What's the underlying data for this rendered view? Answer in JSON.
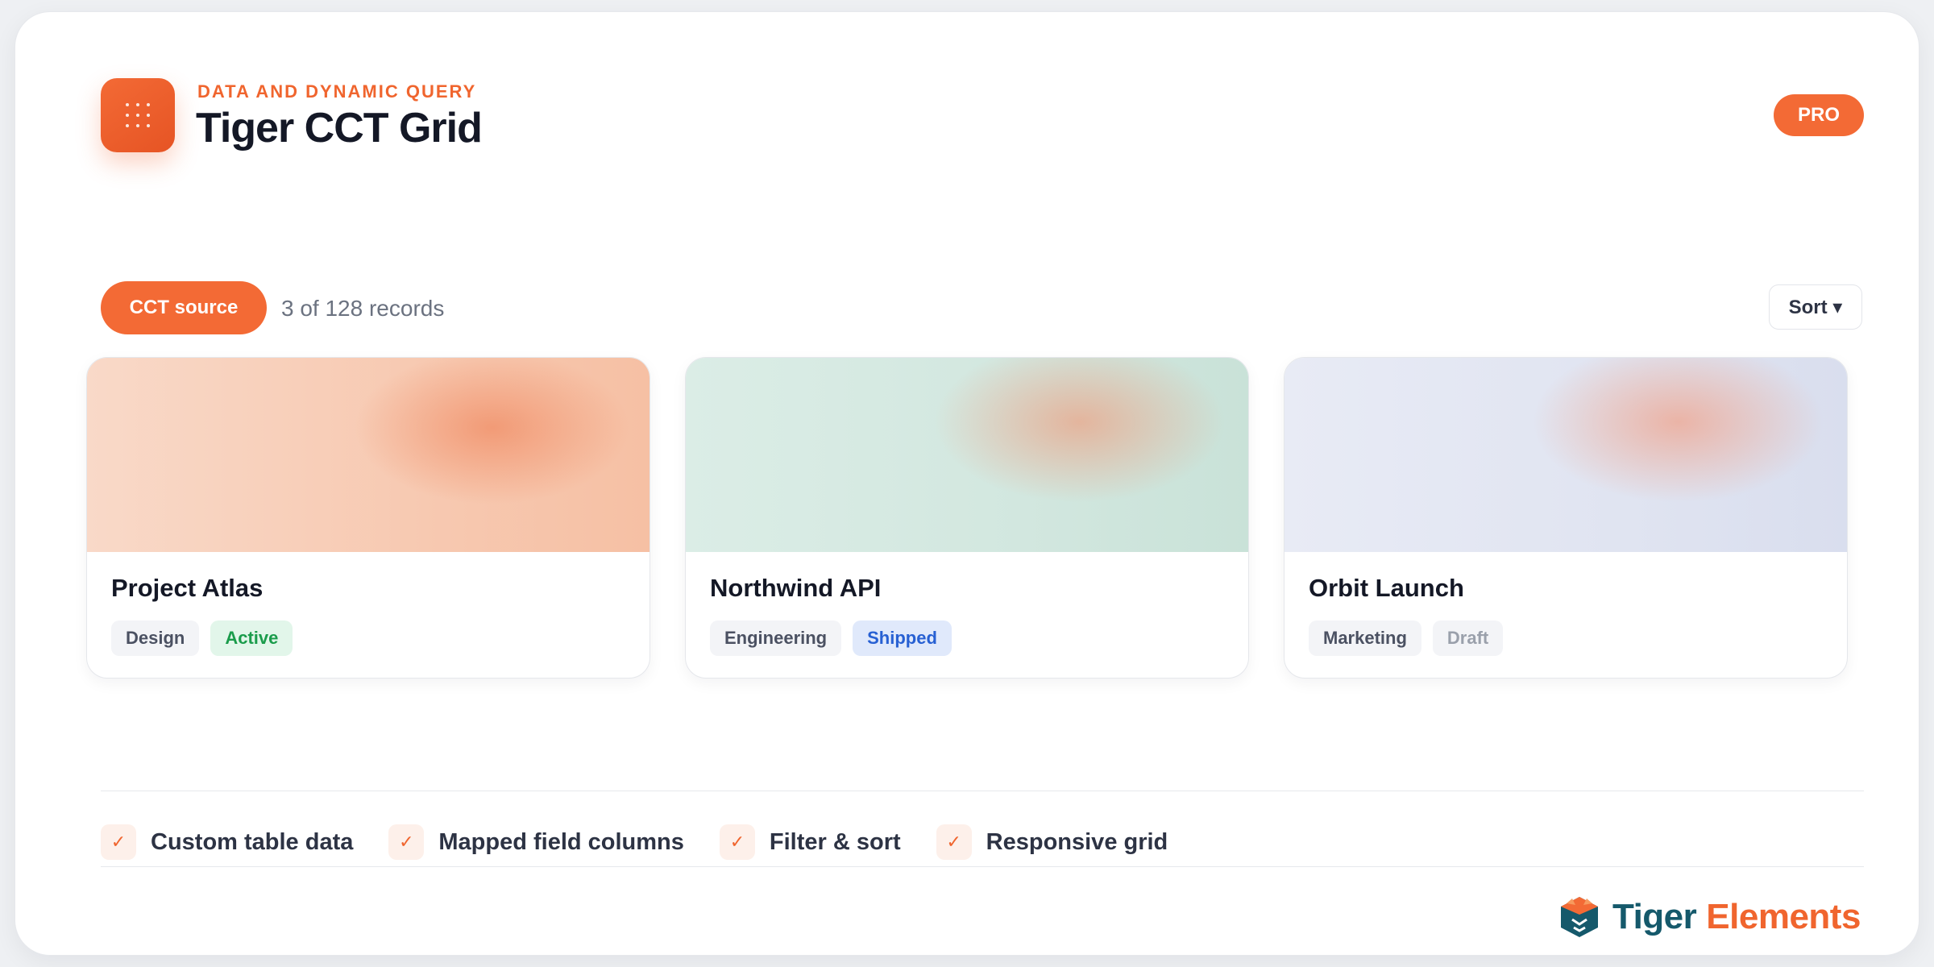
{
  "header": {
    "eyebrow": "DATA AND DYNAMIC QUERY",
    "title": "Tiger CCT Grid",
    "badge": "PRO",
    "icon": "grid-dots-icon"
  },
  "toolbar": {
    "source_label": "CCT source",
    "record_count": "3 of 128 records",
    "sort_label": "Sort ▾"
  },
  "cards": [
    {
      "title": "Project Atlas",
      "category": "Design",
      "status": "Active"
    },
    {
      "title": "Northwind API",
      "category": "Engineering",
      "status": "Shipped"
    },
    {
      "title": "Orbit Launch",
      "category": "Marketing",
      "status": "Draft"
    }
  ],
  "features": [
    {
      "icon": "check-icon",
      "label": "Custom table data"
    },
    {
      "icon": "check-icon",
      "label": "Mapped field columns"
    },
    {
      "icon": "check-icon",
      "label": "Filter & sort"
    },
    {
      "icon": "check-icon",
      "label": "Responsive grid"
    }
  ],
  "brand": {
    "name_part1": "Tiger",
    "name_part2": "Elements"
  },
  "colors": {
    "accent": "#f36a35",
    "status_active": "#1a9c4b",
    "status_shipped": "#2760d3",
    "status_draft": "#9aa0ab",
    "brand_teal": "#15596b"
  }
}
